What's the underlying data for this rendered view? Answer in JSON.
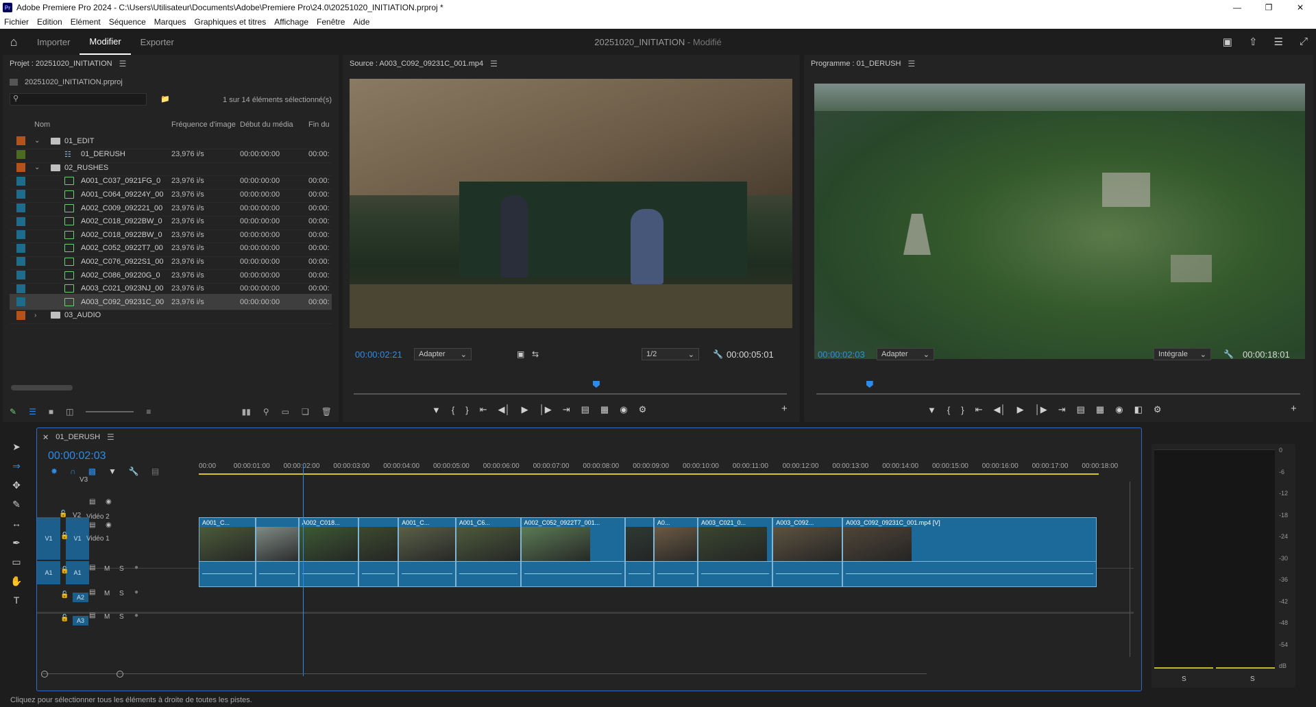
{
  "window": {
    "app_icon": "Pr",
    "title": "Adobe Premiere Pro 2024 - C:\\Users\\Utilisateur\\Documents\\Adobe\\Premiere Pro\\24.0\\20251020_INITIATION.prproj *"
  },
  "menu": [
    "Fichier",
    "Edition",
    "Elément",
    "Séquence",
    "Marques",
    "Graphiques et titres",
    "Affichage",
    "Fenêtre",
    "Aide"
  ],
  "workspace": {
    "tabs": [
      "Importer",
      "Modifier",
      "Exporter"
    ],
    "active_tab": "Modifier",
    "project_name": "20251020_INITIATION",
    "project_state": "- Modifié"
  },
  "project_panel": {
    "title": "Projet : 20251020_INITIATION",
    "file": "20251020_INITIATION.prproj",
    "selection_info": "1 sur 14 éléments sélectionné(s)",
    "columns": [
      "Nom",
      "Fréquence d'image",
      "Début du média",
      "Fin du"
    ],
    "rows": [
      {
        "type": "folder",
        "name": "01_EDIT",
        "fr": "",
        "deb": "",
        "fin": "",
        "color": "#b3521b",
        "expanded": true,
        "level": 0
      },
      {
        "type": "sequence",
        "name": "01_DERUSH",
        "fr": "23,976 i/s",
        "deb": "00:00:00:00",
        "fin": "00:00:",
        "color": "#4b6b1f",
        "level": 1
      },
      {
        "type": "folder",
        "name": "02_RUSHES",
        "fr": "",
        "deb": "",
        "fin": "",
        "color": "#b3521b",
        "expanded": true,
        "level": 0
      },
      {
        "type": "clip",
        "name": "A001_C037_0921FG_0",
        "fr": "23,976 i/s",
        "deb": "00:00:00:00",
        "fin": "00:00:",
        "color": "#1d6c8c",
        "level": 1
      },
      {
        "type": "clip",
        "name": "A001_C064_09224Y_00",
        "fr": "23,976 i/s",
        "deb": "00:00:00:00",
        "fin": "00:00:",
        "color": "#1d6c8c",
        "level": 1
      },
      {
        "type": "clip",
        "name": "A002_C009_092221_00",
        "fr": "23,976 i/s",
        "deb": "00:00:00:00",
        "fin": "00:00:",
        "color": "#1d6c8c",
        "level": 1
      },
      {
        "type": "clip",
        "name": "A002_C018_0922BW_0",
        "fr": "23,976 i/s",
        "deb": "00:00:00:00",
        "fin": "00:00:",
        "color": "#1d6c8c",
        "level": 1
      },
      {
        "type": "clip",
        "name": "A002_C018_0922BW_0",
        "fr": "23,976 i/s",
        "deb": "00:00:00:00",
        "fin": "00:00:",
        "color": "#1d6c8c",
        "level": 1
      },
      {
        "type": "clip",
        "name": "A002_C052_0922T7_00",
        "fr": "23,976 i/s",
        "deb": "00:00:00:00",
        "fin": "00:00:",
        "color": "#1d6c8c",
        "level": 1
      },
      {
        "type": "clip",
        "name": "A002_C076_0922S1_00",
        "fr": "23,976 i/s",
        "deb": "00:00:00:00",
        "fin": "00:00:",
        "color": "#1d6c8c",
        "level": 1
      },
      {
        "type": "clip",
        "name": "A002_C086_09220G_0",
        "fr": "23,976 i/s",
        "deb": "00:00:00:00",
        "fin": "00:00:",
        "color": "#1d6c8c",
        "level": 1
      },
      {
        "type": "clip",
        "name": "A003_C021_0923NJ_00",
        "fr": "23,976 i/s",
        "deb": "00:00:00:00",
        "fin": "00:00:",
        "color": "#1d6c8c",
        "level": 1
      },
      {
        "type": "clip",
        "name": "A003_C092_09231C_00",
        "fr": "23,976 i/s",
        "deb": "00:00:00:00",
        "fin": "00:00:",
        "color": "#1d6c8c",
        "level": 1,
        "selected": true
      },
      {
        "type": "folder",
        "name": "03_AUDIO",
        "fr": "",
        "deb": "",
        "fin": "",
        "color": "#b3521b",
        "expanded": false,
        "level": 0
      }
    ]
  },
  "source_monitor": {
    "title": "Source : A003_C092_09231C_001.mp4",
    "timecode": "00:00:02:21",
    "fit": "Adapter",
    "resolution": "1/2",
    "duration": "00:00:05:01",
    "playhead_fraction": 0.56
  },
  "program_monitor": {
    "title": "Programme : 01_DERUSH",
    "timecode": "00:00:02:03",
    "fit": "Adapter",
    "quality": "Intégrale",
    "duration": "00:00:18:01",
    "playhead_fraction": 0.11
  },
  "timeline": {
    "sequence_name": "01_DERUSH",
    "timecode": "00:00:02:03",
    "ruler": [
      "00:00",
      "00:00:01:00",
      "00:00:02:00",
      "00:00:03:00",
      "00:00:04:00",
      "00:00:05:00",
      "00:00:06:00",
      "00:00:07:00",
      "00:00:08:00",
      "00:00:09:00",
      "00:00:10:00",
      "00:00:11:00",
      "00:00:12:00",
      "00:00:13:00",
      "00:00:14:00",
      "00:00:15:00",
      "00:00:16:00",
      "00:00:17:00",
      "00:00:18:00"
    ],
    "playhead_seconds": 2.09,
    "tracks": {
      "v3": "V3",
      "v2": {
        "id": "V2",
        "name": "Vidéo 2"
      },
      "v1": {
        "id": "V1",
        "src": "V1",
        "name": "Vidéo 1"
      },
      "a1": {
        "id": "A1",
        "src": "A1",
        "m": "M",
        "s": "S"
      },
      "a2": {
        "id": "A2",
        "m": "M",
        "s": "S"
      },
      "a3": {
        "id": "A3",
        "m": "M",
        "s": "S"
      }
    },
    "clips": [
      {
        "label": "A001_C...",
        "start": 0,
        "end": 1.14
      },
      {
        "label": "",
        "start": 1.14,
        "end": 2.0
      },
      {
        "label": "A002_C018...",
        "start": 2.0,
        "end": 3.2
      },
      {
        "label": "",
        "start": 3.2,
        "end": 4.0
      },
      {
        "label": "A001_C...",
        "start": 4.0,
        "end": 5.15
      },
      {
        "label": "A001_C6...",
        "start": 5.15,
        "end": 6.45
      },
      {
        "label": "A002_C052_0922T7_001...",
        "start": 6.45,
        "end": 8.55
      },
      {
        "label": "",
        "start": 8.55,
        "end": 9.12
      },
      {
        "label": "A0...",
        "start": 9.12,
        "end": 10.0
      },
      {
        "label": "A003_C021_0...",
        "start": 10.0,
        "end": 11.5
      },
      {
        "label": "A003_C092...",
        "start": 11.5,
        "end": 12.9
      },
      {
        "label": "A003_C092_09231C_001.mp4 [V]",
        "start": 12.9,
        "end": 18.0
      }
    ]
  },
  "meter_scale": [
    "0",
    "-6",
    "-12",
    "-18",
    "-24",
    "-30",
    "-36",
    "-42",
    "-48",
    "-54",
    "dB"
  ],
  "meter_solo": [
    "S",
    "S"
  ],
  "status_bar": "Cliquez pour sélectionner tous les éléments à droite de toutes les pistes."
}
